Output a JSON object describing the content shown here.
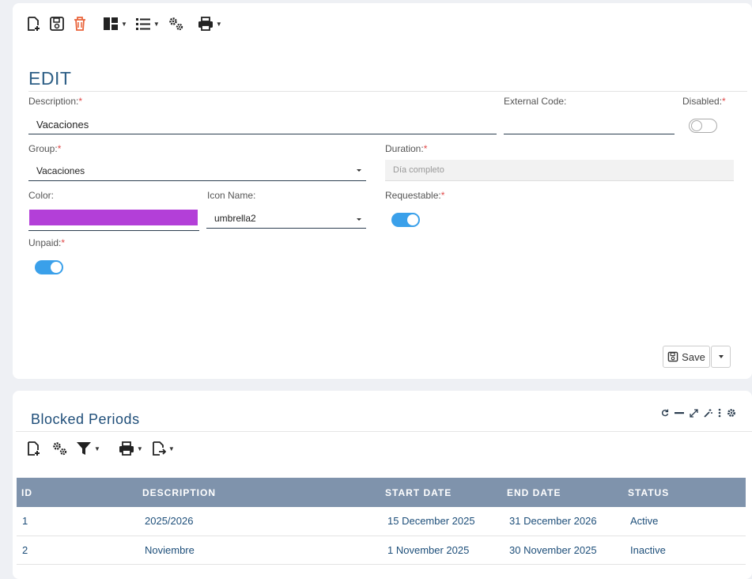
{
  "toolbar": {
    "items": [
      "new-document-icon",
      "save-icon",
      "delete-icon",
      "layout-icon",
      "list-icon",
      "settings-gears-icon",
      "print-icon"
    ],
    "delete_color": "#e9643b"
  },
  "form": {
    "title": "EDIT",
    "description": {
      "label": "Description:",
      "required_mark": "*",
      "value": "Vacaciones"
    },
    "external_code": {
      "label": "External Code:",
      "value": ""
    },
    "disabled": {
      "label": "Disabled:",
      "required_mark": "*",
      "on": false
    },
    "group": {
      "label": "Group:",
      "required_mark": "*",
      "value": "Vacaciones"
    },
    "duration": {
      "label": "Duration:",
      "required_mark": "*",
      "placeholder": "Día completo"
    },
    "color": {
      "label": "Color:",
      "value": "#b33fd8"
    },
    "icon_name": {
      "label": "Icon Name:",
      "value": "umbrella2"
    },
    "requestable": {
      "label": "Requestable:",
      "required_mark": "*",
      "on": true
    },
    "unpaid": {
      "label": "Unpaid:",
      "required_mark": "*",
      "on": true
    },
    "save_label": "Save"
  },
  "blocked_periods": {
    "title": "Blocked Periods",
    "panel_tools": [
      "refresh-icon",
      "minimize-icon",
      "expand-icon",
      "magic-wand-icon",
      "more-vertical-icon",
      "gear-icon"
    ],
    "toolbar": [
      "new-document-icon",
      "settings-gears-icon",
      "filter-icon",
      "print-icon",
      "export-icon"
    ],
    "columns": [
      "ID",
      "DESCRIPTION",
      "START DATE",
      "END DATE",
      "STATUS"
    ],
    "rows": [
      {
        "id": "1",
        "description": "2025/2026",
        "start": "15 December 2025",
        "end": "31 December 2026",
        "status": "Active"
      },
      {
        "id": "2",
        "description": "Noviembre",
        "start": "1 November 2025",
        "end": "30 November 2025",
        "status": "Inactive"
      }
    ]
  },
  "colors": {
    "accent": "#2d5f86",
    "header_bg": "#7f93ac",
    "toggle_on": "#3aa0ea",
    "active": "#26a06a",
    "inactive": "#b9c0c6"
  }
}
